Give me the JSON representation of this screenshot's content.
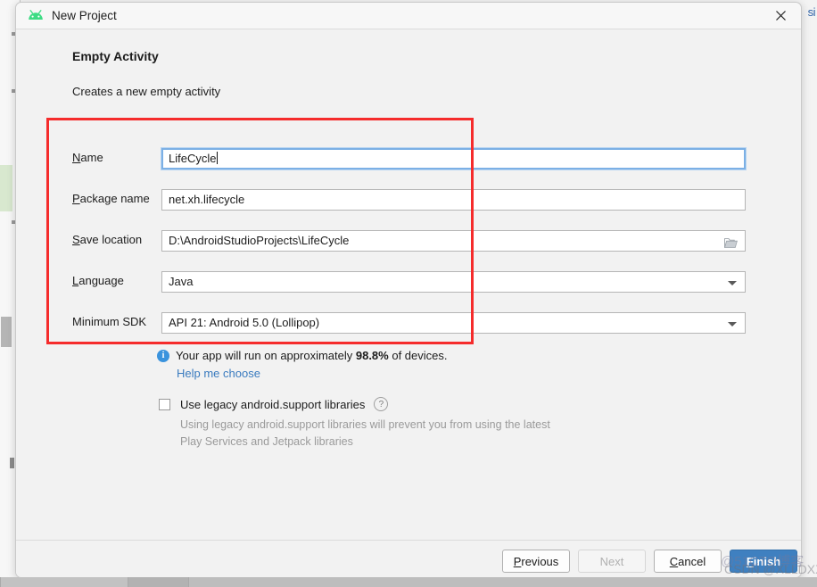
{
  "background": {
    "edge_text": "si"
  },
  "titlebar": {
    "icon": "android-logo-icon",
    "title": "New Project",
    "close_label": "✕"
  },
  "page": {
    "heading": "Empty Activity",
    "subheading": "Creates a new empty activity"
  },
  "form": {
    "fields": [
      {
        "label_prefix": "",
        "label_mnemonic": "N",
        "label_suffix": "ame",
        "value": "LifeCycle",
        "type": "text",
        "focused": true
      },
      {
        "label_prefix": "",
        "label_mnemonic": "P",
        "label_suffix": "ackage name",
        "value": "net.xh.lifecycle",
        "type": "text",
        "focused": false
      },
      {
        "label_prefix": "",
        "label_mnemonic": "S",
        "label_suffix": "ave location",
        "value": "D:\\AndroidStudioProjects\\LifeCycle",
        "type": "path",
        "focused": false
      },
      {
        "label_prefix": "",
        "label_mnemonic": "L",
        "label_suffix": "anguage",
        "value": "Java",
        "type": "combo",
        "focused": false
      },
      {
        "label_prefix": "Minimum SDK",
        "label_mnemonic": "",
        "label_suffix": "",
        "value": "API 21: Android 5.0 (Lollipop)",
        "type": "combo",
        "focused": false
      }
    ]
  },
  "info": {
    "icon": "info-icon",
    "text_before": "Your app will run on approximately ",
    "percent": "98.8%",
    "text_after": " of devices.",
    "help_link": "Help me choose"
  },
  "legacy": {
    "checkbox_checked": false,
    "label": "Use legacy android.support libraries",
    "help_icon": "?",
    "description": "Using legacy android.support libraries will prevent you from using the latest Play Services and Jetpack libraries"
  },
  "footer": {
    "previous": {
      "prefix": "",
      "mnemonic": "P",
      "suffix": "revious",
      "enabled": true
    },
    "next": {
      "prefix": "",
      "mnemonic": "",
      "suffix": "Next",
      "enabled": false
    },
    "cancel": {
      "prefix": "",
      "mnemonic": "C",
      "suffix": "ancel",
      "enabled": true
    },
    "finish": {
      "prefix": "",
      "mnemonic": "F",
      "suffix": "inish",
      "enabled": true
    }
  },
  "watermarks": {
    "first": "@51CTO博客",
    "second": "CSDN @XLLDXX"
  },
  "colors": {
    "accent": "#3f80c0",
    "annotation": "#f52c2c",
    "link": "#3a7bbf",
    "android_green": "#3ddc84"
  }
}
